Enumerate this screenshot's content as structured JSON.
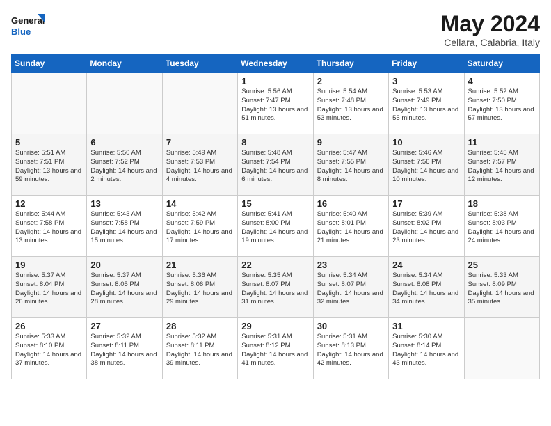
{
  "header": {
    "logo_line1": "General",
    "logo_line2": "Blue",
    "month": "May 2024",
    "location": "Cellara, Calabria, Italy"
  },
  "weekdays": [
    "Sunday",
    "Monday",
    "Tuesday",
    "Wednesday",
    "Thursday",
    "Friday",
    "Saturday"
  ],
  "weeks": [
    [
      {
        "day": "",
        "text": ""
      },
      {
        "day": "",
        "text": ""
      },
      {
        "day": "",
        "text": ""
      },
      {
        "day": "1",
        "text": "Sunrise: 5:56 AM\nSunset: 7:47 PM\nDaylight: 13 hours and 51 minutes."
      },
      {
        "day": "2",
        "text": "Sunrise: 5:54 AM\nSunset: 7:48 PM\nDaylight: 13 hours and 53 minutes."
      },
      {
        "day": "3",
        "text": "Sunrise: 5:53 AM\nSunset: 7:49 PM\nDaylight: 13 hours and 55 minutes."
      },
      {
        "day": "4",
        "text": "Sunrise: 5:52 AM\nSunset: 7:50 PM\nDaylight: 13 hours and 57 minutes."
      }
    ],
    [
      {
        "day": "5",
        "text": "Sunrise: 5:51 AM\nSunset: 7:51 PM\nDaylight: 13 hours and 59 minutes."
      },
      {
        "day": "6",
        "text": "Sunrise: 5:50 AM\nSunset: 7:52 PM\nDaylight: 14 hours and 2 minutes."
      },
      {
        "day": "7",
        "text": "Sunrise: 5:49 AM\nSunset: 7:53 PM\nDaylight: 14 hours and 4 minutes."
      },
      {
        "day": "8",
        "text": "Sunrise: 5:48 AM\nSunset: 7:54 PM\nDaylight: 14 hours and 6 minutes."
      },
      {
        "day": "9",
        "text": "Sunrise: 5:47 AM\nSunset: 7:55 PM\nDaylight: 14 hours and 8 minutes."
      },
      {
        "day": "10",
        "text": "Sunrise: 5:46 AM\nSunset: 7:56 PM\nDaylight: 14 hours and 10 minutes."
      },
      {
        "day": "11",
        "text": "Sunrise: 5:45 AM\nSunset: 7:57 PM\nDaylight: 14 hours and 12 minutes."
      }
    ],
    [
      {
        "day": "12",
        "text": "Sunrise: 5:44 AM\nSunset: 7:58 PM\nDaylight: 14 hours and 13 minutes."
      },
      {
        "day": "13",
        "text": "Sunrise: 5:43 AM\nSunset: 7:58 PM\nDaylight: 14 hours and 15 minutes."
      },
      {
        "day": "14",
        "text": "Sunrise: 5:42 AM\nSunset: 7:59 PM\nDaylight: 14 hours and 17 minutes."
      },
      {
        "day": "15",
        "text": "Sunrise: 5:41 AM\nSunset: 8:00 PM\nDaylight: 14 hours and 19 minutes."
      },
      {
        "day": "16",
        "text": "Sunrise: 5:40 AM\nSunset: 8:01 PM\nDaylight: 14 hours and 21 minutes."
      },
      {
        "day": "17",
        "text": "Sunrise: 5:39 AM\nSunset: 8:02 PM\nDaylight: 14 hours and 23 minutes."
      },
      {
        "day": "18",
        "text": "Sunrise: 5:38 AM\nSunset: 8:03 PM\nDaylight: 14 hours and 24 minutes."
      }
    ],
    [
      {
        "day": "19",
        "text": "Sunrise: 5:37 AM\nSunset: 8:04 PM\nDaylight: 14 hours and 26 minutes."
      },
      {
        "day": "20",
        "text": "Sunrise: 5:37 AM\nSunset: 8:05 PM\nDaylight: 14 hours and 28 minutes."
      },
      {
        "day": "21",
        "text": "Sunrise: 5:36 AM\nSunset: 8:06 PM\nDaylight: 14 hours and 29 minutes."
      },
      {
        "day": "22",
        "text": "Sunrise: 5:35 AM\nSunset: 8:07 PM\nDaylight: 14 hours and 31 minutes."
      },
      {
        "day": "23",
        "text": "Sunrise: 5:34 AM\nSunset: 8:07 PM\nDaylight: 14 hours and 32 minutes."
      },
      {
        "day": "24",
        "text": "Sunrise: 5:34 AM\nSunset: 8:08 PM\nDaylight: 14 hours and 34 minutes."
      },
      {
        "day": "25",
        "text": "Sunrise: 5:33 AM\nSunset: 8:09 PM\nDaylight: 14 hours and 35 minutes."
      }
    ],
    [
      {
        "day": "26",
        "text": "Sunrise: 5:33 AM\nSunset: 8:10 PM\nDaylight: 14 hours and 37 minutes."
      },
      {
        "day": "27",
        "text": "Sunrise: 5:32 AM\nSunset: 8:11 PM\nDaylight: 14 hours and 38 minutes."
      },
      {
        "day": "28",
        "text": "Sunrise: 5:32 AM\nSunset: 8:11 PM\nDaylight: 14 hours and 39 minutes."
      },
      {
        "day": "29",
        "text": "Sunrise: 5:31 AM\nSunset: 8:12 PM\nDaylight: 14 hours and 41 minutes."
      },
      {
        "day": "30",
        "text": "Sunrise: 5:31 AM\nSunset: 8:13 PM\nDaylight: 14 hours and 42 minutes."
      },
      {
        "day": "31",
        "text": "Sunrise: 5:30 AM\nSunset: 8:14 PM\nDaylight: 14 hours and 43 minutes."
      },
      {
        "day": "",
        "text": ""
      }
    ]
  ]
}
